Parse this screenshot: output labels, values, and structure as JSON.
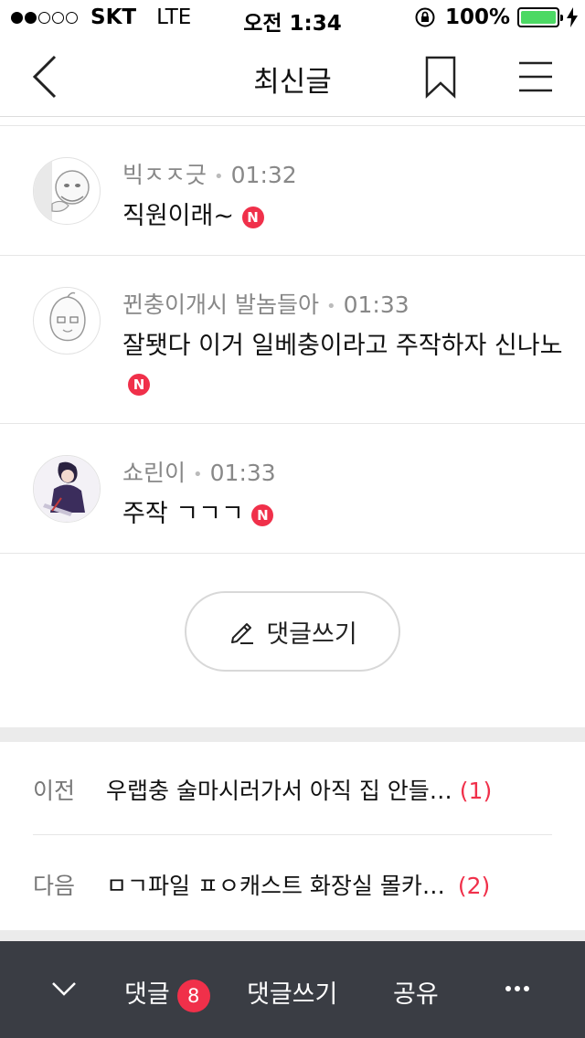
{
  "status_bar": {
    "carrier": "SKT",
    "network": "LTE",
    "time": "오전 1:34",
    "battery": "100%",
    "signal_icon": "signal-dots-icon",
    "battery_color": "#4cd964"
  },
  "navbar": {
    "title": "최신글",
    "back_icon": "chevron-left-icon",
    "bookmark_icon": "bookmark-icon",
    "menu_icon": "hamburger-menu-icon"
  },
  "comments": [
    {
      "author": "빅ㅈㅈ긋",
      "time": "01:32",
      "text": "직원이래~",
      "badge": "N"
    },
    {
      "author": "뀐충이개시 발놈들아",
      "time": "01:33",
      "text": "잘됏다 이거 일베충이라고 주작하자 신나노",
      "badge": "N"
    },
    {
      "author": "쇼린이",
      "time": "01:33",
      "text": "주작 ㄱㄱㄱ",
      "badge": "N"
    }
  ],
  "write_button": {
    "label": "댓글쓰기",
    "icon": "pencil-icon"
  },
  "prev_post": {
    "label": "이전",
    "title": "우랩충 술마시러가서 아직 집 안들…",
    "count": "(1)"
  },
  "next_post": {
    "label": "다음",
    "title": "ㅁㄱ파일 ㅍㅇ캐스트 화장실 몰카…",
    "count": "(2)"
  },
  "toolbar": {
    "collapse_icon": "chevron-down-icon",
    "comments_label": "댓글",
    "comments_count": "8",
    "write_label": "댓글쓰기",
    "share_label": "공유",
    "more_icon": "more-dots-icon",
    "background": "#3a3d44",
    "accent": "#f0304a"
  }
}
